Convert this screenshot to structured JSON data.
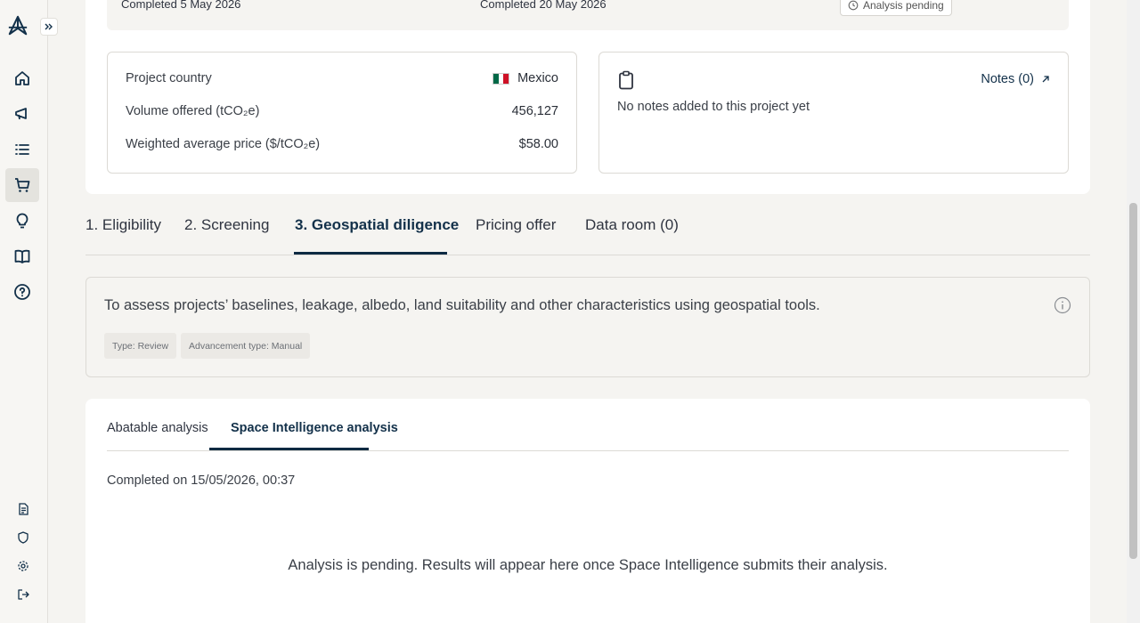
{
  "sidebar": {
    "logo_icon": "brand-logo-icon",
    "expand_icon": "double-chevron-right-icon",
    "items": [
      {
        "icon": "home-icon"
      },
      {
        "icon": "megaphone-icon"
      },
      {
        "icon": "list-icon"
      },
      {
        "icon": "cart-icon",
        "active": true
      },
      {
        "icon": "lightbulb-icon"
      },
      {
        "icon": "book-icon"
      },
      {
        "icon": "help-icon"
      }
    ],
    "bottom_items": [
      {
        "icon": "document-icon"
      },
      {
        "icon": "shield-icon"
      },
      {
        "icon": "settings-icon"
      },
      {
        "icon": "logout-icon"
      }
    ]
  },
  "top_card": {
    "completed_left": "Completed 5 May 2026",
    "completed_middle": "Completed 20 May 2026",
    "pending_badge": "Analysis pending"
  },
  "project_info": {
    "country_label": "Project country",
    "country_value": "Mexico",
    "volume_label": "Volume offered (tCO₂e)",
    "volume_value": "456,127",
    "price_label": "Weighted average price ($/tCO₂e)",
    "price_value": "$58.00"
  },
  "notes": {
    "link_label": "Notes (0)",
    "empty_text": "No notes added to this project yet"
  },
  "tabs": [
    {
      "label": "1. Eligibility"
    },
    {
      "label": "2. Screening"
    },
    {
      "label": "3. Geospatial diligence",
      "active": true
    },
    {
      "label": "Pricing offer"
    },
    {
      "label": "Data room (0)"
    }
  ],
  "description": {
    "text": "To assess projects’ baselines, leakage, albedo, land suitability and other characteristics using geospatial tools.",
    "type_tag": "Type: Review",
    "advancement_tag": "Advancement type: Manual"
  },
  "analysis": {
    "subtabs": [
      {
        "label": "Abatable analysis"
      },
      {
        "label": "Space Intelligence analysis",
        "active": true
      }
    ],
    "completed_on": "Completed on 15/05/2026, 00:37",
    "pending_message": "Analysis is pending. Results will appear here once Space Intelligence submits their analysis."
  },
  "colors": {
    "accent_dark": "#0d2a42",
    "page_bg": "#f5f4f1",
    "flag_green": "#006847",
    "flag_red": "#ce1126"
  }
}
